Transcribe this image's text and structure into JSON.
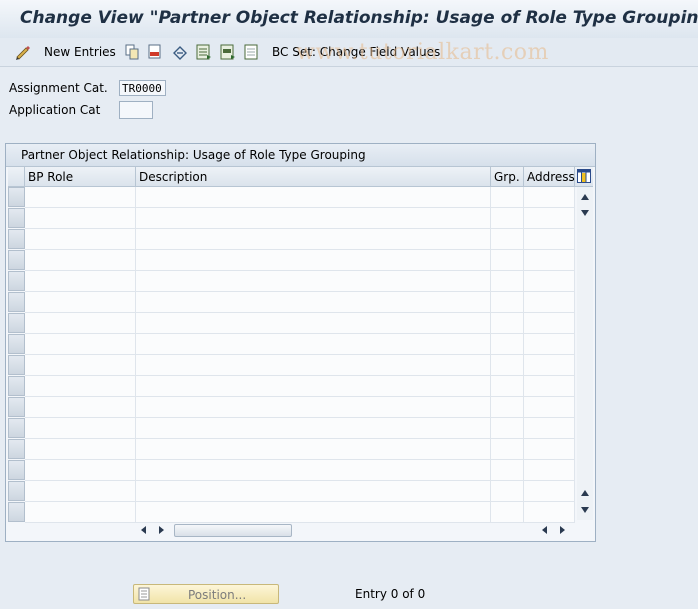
{
  "window": {
    "title": "Change View \"Partner Object Relationship: Usage of Role Type Grouping\""
  },
  "toolbar": {
    "new_entries_label": "New Entries",
    "bc_set_label": "BC Set: Change Field Values"
  },
  "watermark": "www.tutorialkart.com",
  "fields": {
    "assignment_cat_label": "Assignment Cat.",
    "assignment_cat_value": "TR0000",
    "application_cat_label": "Application Cat",
    "application_cat_value": ""
  },
  "table": {
    "title": "Partner Object Relationship: Usage of Role Type Grouping",
    "columns": [
      "BP Role",
      "Description",
      "Grp.",
      "Address"
    ],
    "rows": []
  },
  "footer": {
    "position_label": "Position...",
    "entry_text": "Entry 0 of 0"
  }
}
